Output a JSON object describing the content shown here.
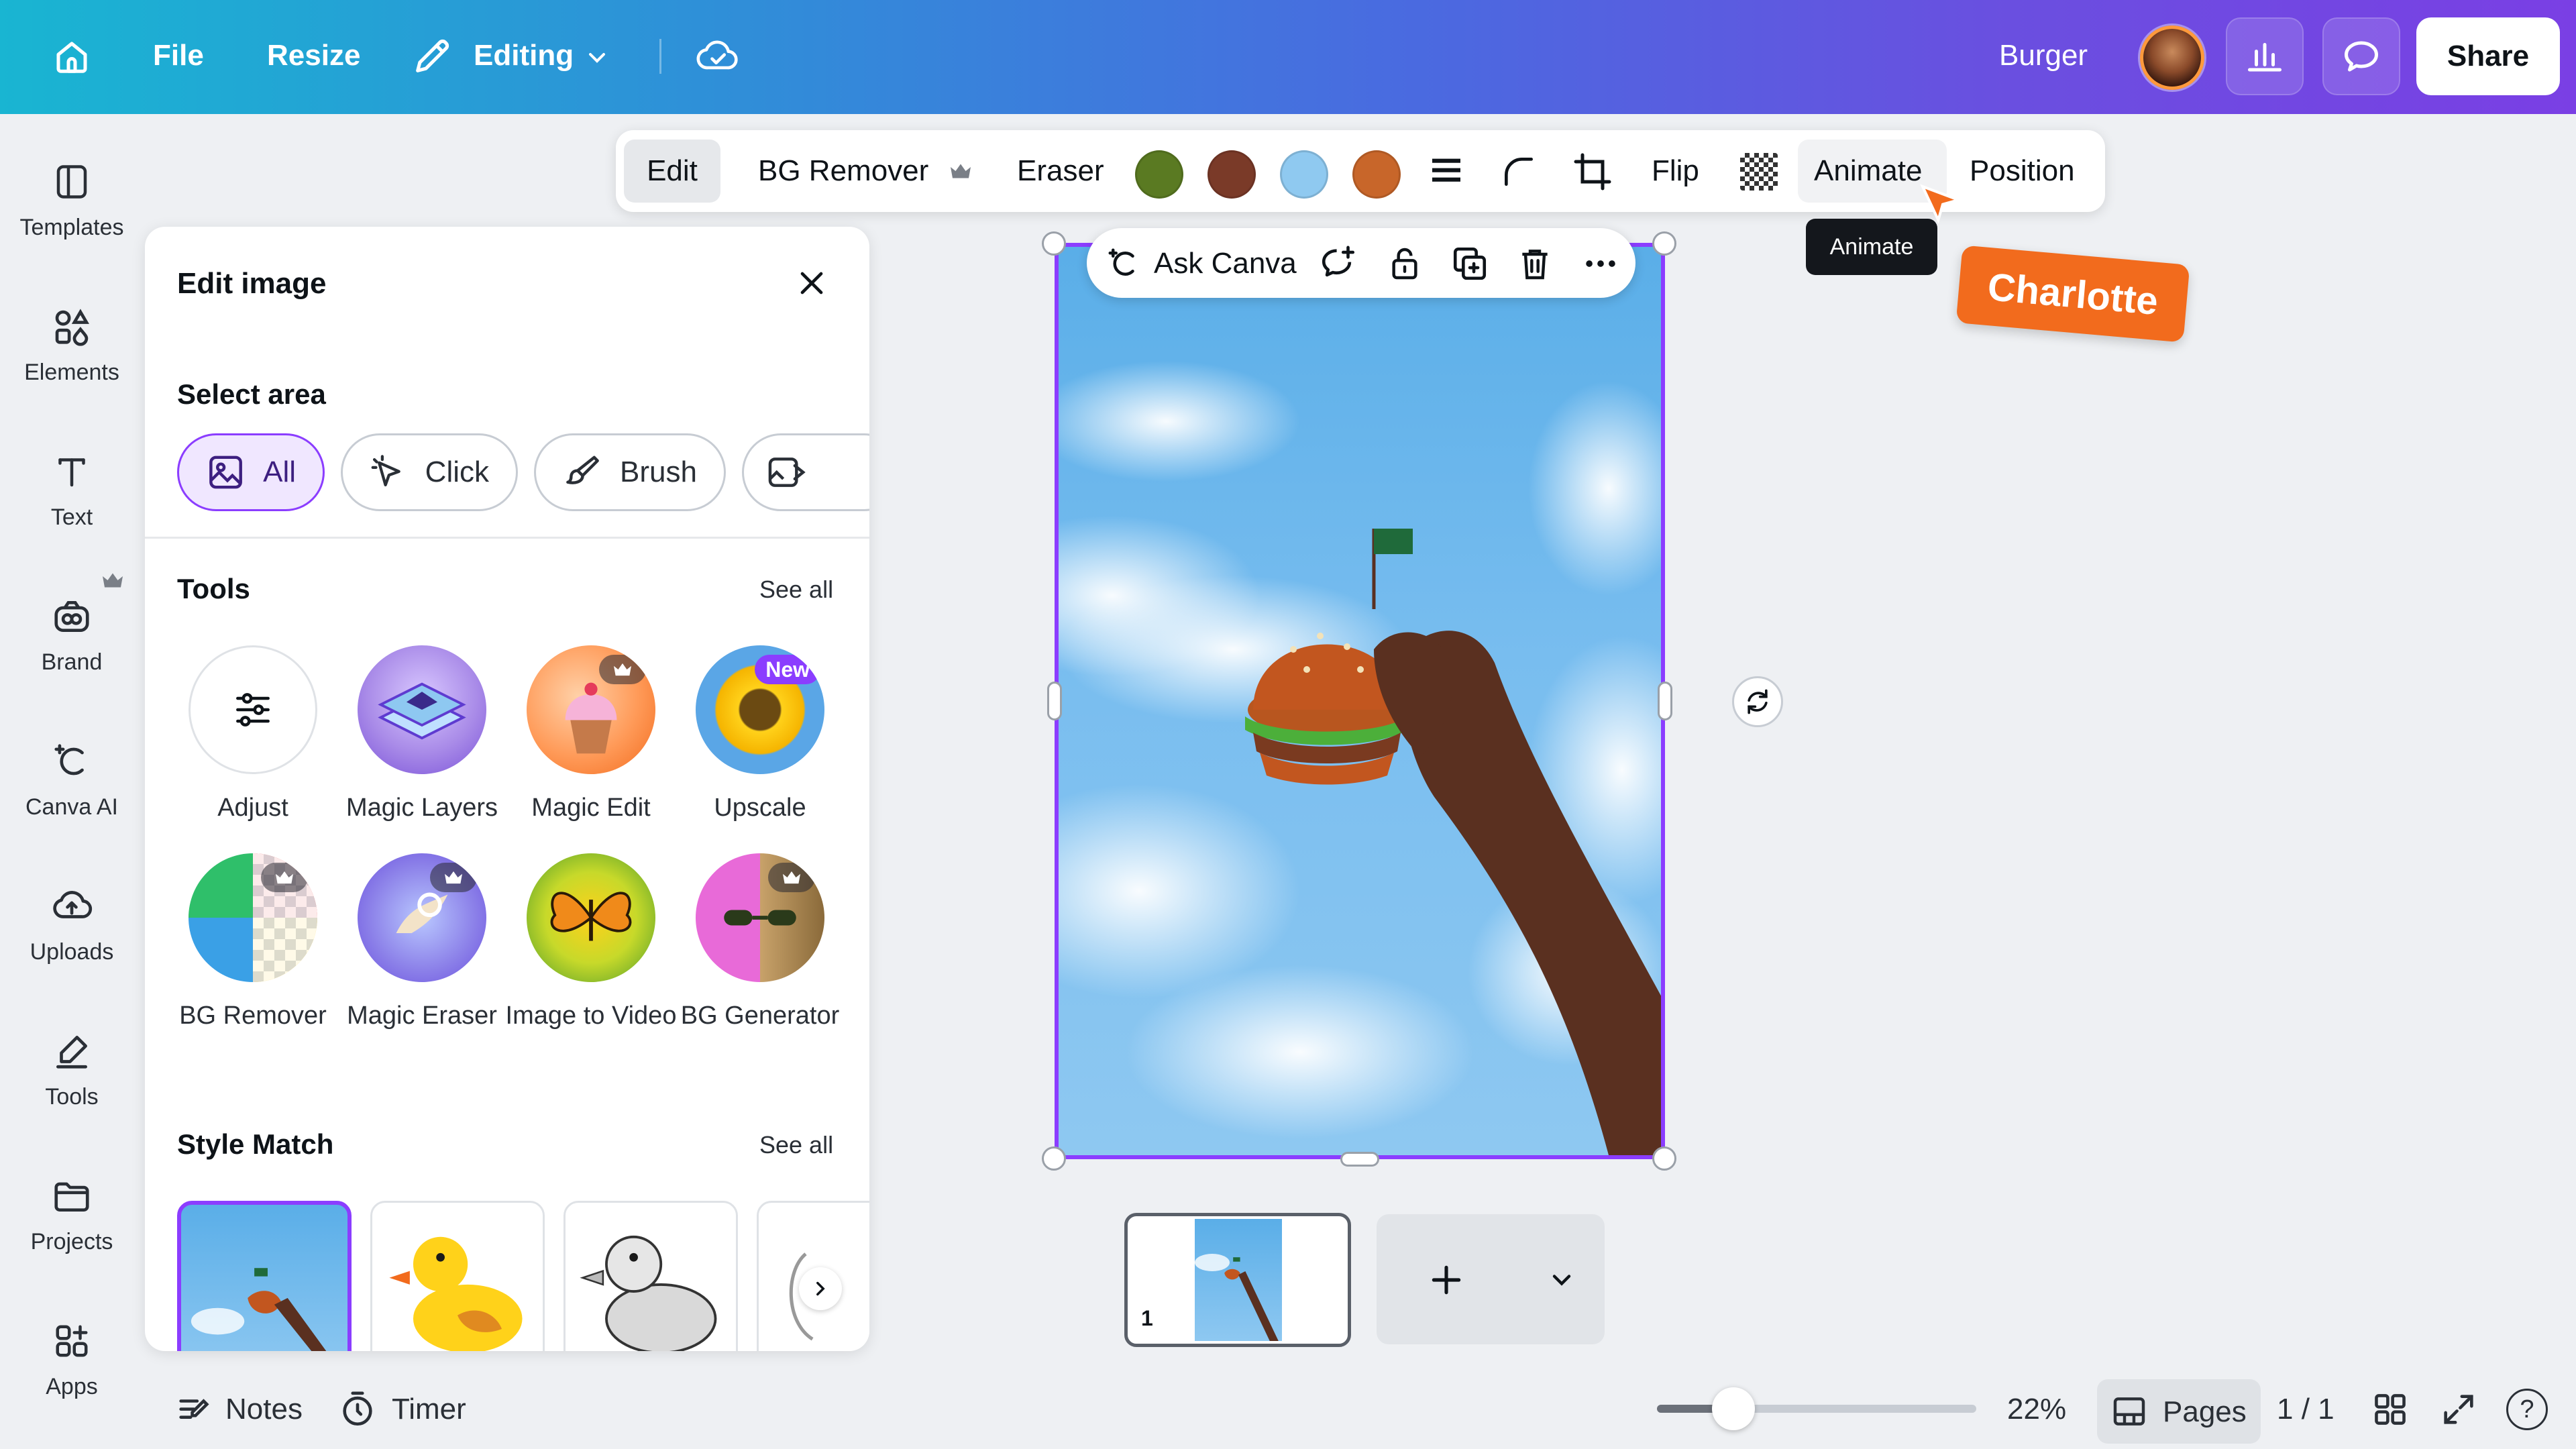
{
  "topbar": {
    "file_label": "File",
    "resize_label": "Resize",
    "mode_label": "Editing",
    "project_name": "Burger",
    "share_label": "Share",
    "gradient_start": "#19b5d2",
    "gradient_end": "#7a3fe4"
  },
  "rail": {
    "items": [
      {
        "label": "Templates",
        "icon": "templates-icon"
      },
      {
        "label": "Elements",
        "icon": "elements-icon"
      },
      {
        "label": "Text",
        "icon": "text-icon"
      },
      {
        "label": "Brand",
        "icon": "brand-icon"
      },
      {
        "label": "Canva AI",
        "icon": "canva-ai-icon"
      },
      {
        "label": "Uploads",
        "icon": "uploads-icon"
      },
      {
        "label": "Tools",
        "icon": "tools-icon"
      },
      {
        "label": "Projects",
        "icon": "projects-icon"
      },
      {
        "label": "Apps",
        "icon": "apps-icon"
      }
    ]
  },
  "panel": {
    "title": "Edit image",
    "select_area_title": "Select area",
    "select_options": [
      "All",
      "Click",
      "Brush"
    ],
    "selected_option": "All",
    "tools_title": "Tools",
    "tools_see_all": "See all",
    "tools": [
      {
        "label": "Adjust",
        "icon": "adjust-icon"
      },
      {
        "label": "Magic Layers",
        "icon": "magic-layers-icon"
      },
      {
        "label": "Magic Edit",
        "icon": "magic-edit-icon",
        "badge": "crown"
      },
      {
        "label": "Upscale",
        "icon": "upscale-icon",
        "badge": "New"
      },
      {
        "label": "BG Remover",
        "icon": "bg-remover-icon",
        "badge": "crown"
      },
      {
        "label": "Magic Eraser",
        "icon": "magic-eraser-icon",
        "badge": "crown"
      },
      {
        "label": "Image to Video",
        "icon": "image-to-video-icon"
      },
      {
        "label": "BG Generator",
        "icon": "bg-generator-icon",
        "badge": "crown"
      }
    ],
    "style_match_title": "Style Match",
    "style_see_all": "See all"
  },
  "context_toolbar": {
    "edit_label": "Edit",
    "bg_remover_label": "BG Remover",
    "eraser_label": "Eraser",
    "swatches": [
      "#5a7a22",
      "#7a3a28",
      "#8fc9f0",
      "#c8662a"
    ],
    "flip_label": "Flip",
    "animate_label": "Animate",
    "position_label": "Position",
    "tooltip": "Animate"
  },
  "collaborator": {
    "name": "Charlotte",
    "color": "#f26b1d"
  },
  "ask_canva": {
    "label": "Ask Canva"
  },
  "accent_color": "#8b3dff",
  "pages": {
    "thumb_number": "1"
  },
  "bottombar": {
    "notes_label": "Notes",
    "timer_label": "Timer",
    "zoom_level": "22%",
    "zoom_fraction": 0.09,
    "pages_label": "Pages",
    "page_counter": "1 / 1",
    "help_label": "?"
  }
}
